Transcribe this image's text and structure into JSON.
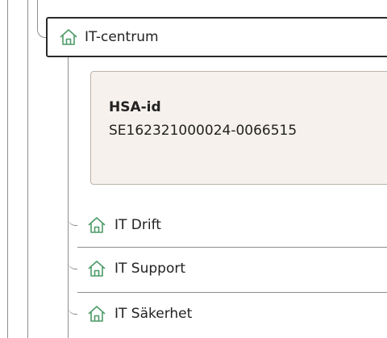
{
  "tree": {
    "selected": {
      "label": "IT-centrum",
      "icon": "home-icon",
      "details": {
        "label": "HSA-id",
        "value": "SE162321000024-0066515"
      }
    },
    "children": [
      {
        "label": "IT Drift",
        "icon": "home-icon"
      },
      {
        "label": "IT Support",
        "icon": "home-icon"
      },
      {
        "label": "IT Säkerhet",
        "icon": "home-icon"
      }
    ]
  },
  "colors": {
    "icon_green": "#4c9a67",
    "card_background": "#f6f1ec",
    "card_border": "#bcb4ad",
    "selected_border": "#2a2a2a",
    "guide_lines": "#8e8e8e"
  }
}
